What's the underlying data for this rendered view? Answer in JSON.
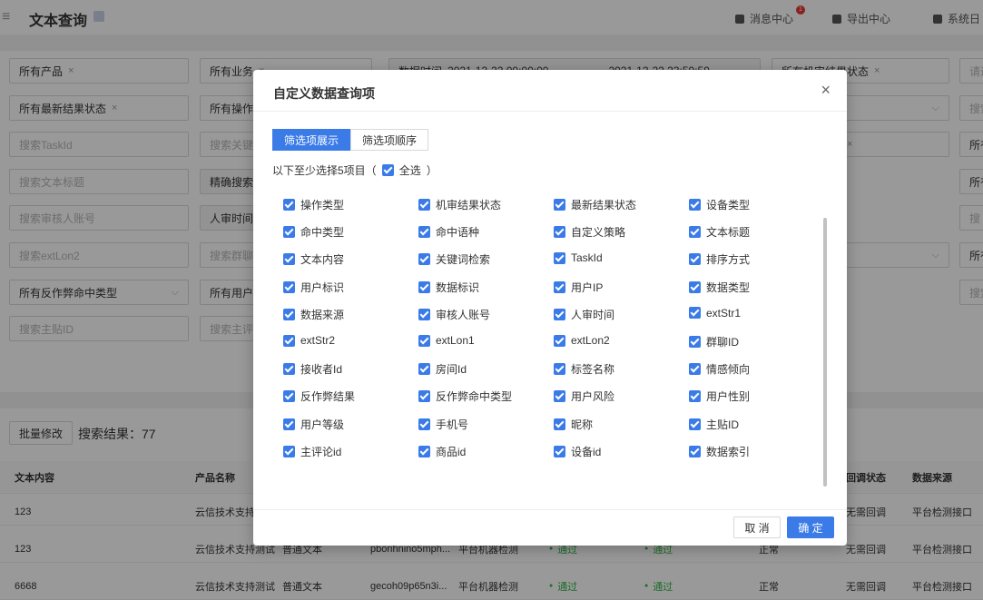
{
  "header": {
    "menu_icon": "≡",
    "title": "文本查询",
    "messages": "消息中心",
    "messages_badge": "1",
    "export": "导出中心",
    "system": "系统日"
  },
  "filters": {
    "product": "所有产品",
    "business": "所有业务",
    "time_label": "数据时间",
    "time_start": "2021-12-22 00:00:00",
    "time_end": "2021-12-22 23:59:59",
    "machine_result": "所有机审结果状态",
    "latest_result": "所有最新结果状态",
    "operation": "所有操作",
    "taskid_ph": "搜索TaskId",
    "keyword_ph": "搜索关键",
    "title_ph": "搜索文本标题",
    "exact_search": "精确搜索",
    "reviewer_ph": "搜索审核人账号",
    "manual_time": "人审时间",
    "extlon2_ph": "搜索extLon2",
    "group_ph": "搜索群聊",
    "anti_fraud": "所有反作弊命中类型",
    "all_users": "所有用户",
    "post_ph": "搜索主贴ID",
    "comment_ph": "搜索主评",
    "right_please": "请选",
    "right_search": "搜索",
    "right_all": "所有",
    "right_search2": "搜",
    "right_search3": "搜索"
  },
  "results": {
    "batch_button": "批量修改",
    "result_label": "搜索结果：77",
    "columns": [
      "文本内容",
      "产品名称",
      "回调状态",
      "数据来源"
    ],
    "rows": [
      {
        "content": "123",
        "product": "云信技术支持测",
        "type": "",
        "id": "",
        "source_detect": "",
        "status1": "",
        "status2": "",
        "normal": "",
        "callback": "无需回调",
        "source": "平台检测接口"
      },
      {
        "content": "123",
        "product": "云信技术支持测试",
        "type": "普通文本",
        "id": "pborihnino5mph...",
        "source_detect": "平台机器检测",
        "status1": "通过",
        "status2": "通过",
        "normal": "正常",
        "callback": "无需回调",
        "source": "平台检测接口"
      },
      {
        "content": "6668",
        "product": "云信技术支持测试",
        "type": "普通文本",
        "id": "gecoh09p65n3i...",
        "source_detect": "平台机器检测",
        "status1": "通过",
        "status2": "通过",
        "normal": "正常",
        "callback": "无需回调",
        "source": "平台检测接口"
      }
    ]
  },
  "modal": {
    "title": "自定义数据查询项",
    "close": "×",
    "tabs": [
      "筛选项展示",
      "筛选项顺序"
    ],
    "select_hint": "以下至少选择5项目（",
    "select_all": "全选",
    "select_hint_end": "）",
    "options": [
      "操作类型",
      "机审结果状态",
      "最新结果状态",
      "设备类型",
      "命中类型",
      "命中语种",
      "自定义策略",
      "文本标题",
      "文本内容",
      "关键词检索",
      "TaskId",
      "排序方式",
      "用户标识",
      "数据标识",
      "用户IP",
      "数据类型",
      "数据来源",
      "审核人账号",
      "人审时间",
      "extStr1",
      "extStr2",
      "extLon1",
      "extLon2",
      "群聊ID",
      "接收者Id",
      "房间Id",
      "标签名称",
      "情感倾向",
      "反作弊结果",
      "反作弊命中类型",
      "用户风险",
      "用户性别",
      "用户等级",
      "手机号",
      "昵称",
      "主贴ID",
      "主评论id",
      "商品id",
      "设备id",
      "数据索引"
    ],
    "cancel": "取 消",
    "confirm": "确 定"
  }
}
